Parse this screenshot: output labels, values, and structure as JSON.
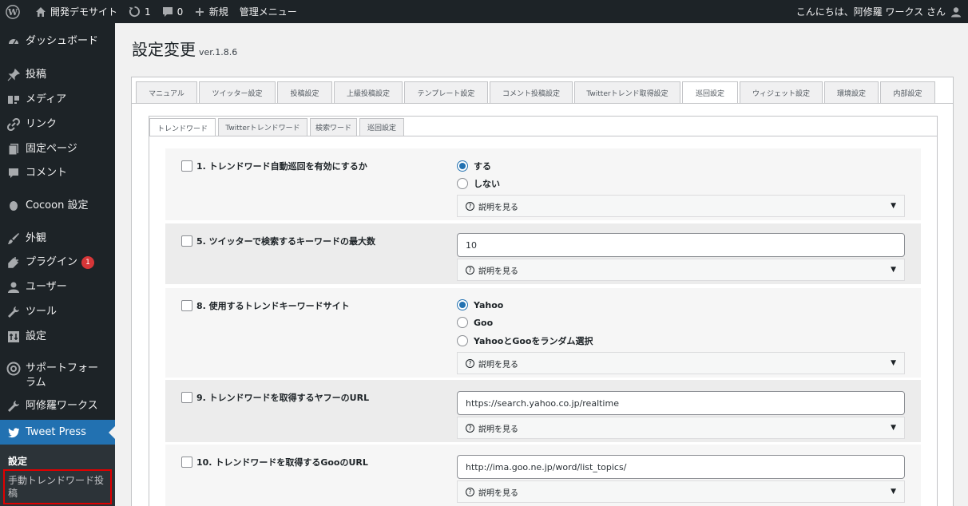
{
  "adminbar": {
    "site_name": "開発デモサイト",
    "updates_count": "1",
    "comments_count": "0",
    "new_label": "新規",
    "admin_menu_label": "管理メニュー",
    "greeting": "こんにちは、阿修羅 ワークス さん"
  },
  "sidebar": {
    "items": [
      {
        "label": "ダッシュボード",
        "icon": "dashboard-icon"
      },
      {
        "label": "投稿",
        "icon": "pin-icon"
      },
      {
        "label": "メディア",
        "icon": "media-icon"
      },
      {
        "label": "リンク",
        "icon": "link-icon"
      },
      {
        "label": "固定ページ",
        "icon": "page-icon"
      },
      {
        "label": "コメント",
        "icon": "comment-icon"
      },
      {
        "label": "Cocoon 設定",
        "icon": "cocoon-icon"
      },
      {
        "label": "外観",
        "icon": "brush-icon"
      },
      {
        "label": "プラグイン",
        "icon": "plugin-icon",
        "badge": "1"
      },
      {
        "label": "ユーザー",
        "icon": "user-icon"
      },
      {
        "label": "ツール",
        "icon": "wrench-icon"
      },
      {
        "label": "設定",
        "icon": "settings-icon"
      },
      {
        "label": "サポートフォーラム",
        "icon": "support-icon"
      },
      {
        "label": "阿修羅ワークス",
        "icon": "wrench-icon"
      },
      {
        "label": "Tweet Press",
        "icon": "twitter-icon"
      }
    ],
    "submenu": {
      "settings_label": "設定",
      "manual_post_label": "手動トレンドワード投稿"
    }
  },
  "page": {
    "title": "設定変更",
    "version": "ver.1.8.6"
  },
  "main_tabs": [
    "マニュアル",
    "ツイッター設定",
    "投稿設定",
    "上級投稿設定",
    "テンプレート設定",
    "コメント投稿設定",
    "Twitterトレンド取得設定",
    "巡回設定",
    "ウィジェット設定",
    "環境設定",
    "内部設定"
  ],
  "active_main_tab": "巡回設定",
  "sub_tabs": [
    "トレンドワード",
    "Twitterトレンドワード",
    "検索ワード",
    "巡回設定"
  ],
  "active_sub_tab": "トレンドワード",
  "desc_label": "説明を見る",
  "settings": {
    "s1": {
      "label": "1. トレンドワード自動巡回を有効にするか",
      "options": [
        "する",
        "しない"
      ],
      "selected": "する"
    },
    "s5": {
      "label": "5. ツイッターで検索するキーワードの最大数",
      "value": "10"
    },
    "s8": {
      "label": "8. 使用するトレンドキーワードサイト",
      "options": [
        "Yahoo",
        "Goo",
        "YahooとGooをランダム選択"
      ],
      "selected": "Yahoo"
    },
    "s9": {
      "label": "9. トレンドワードを取得するヤフーのURL",
      "value": "https://search.yahoo.co.jp/realtime"
    },
    "s10": {
      "label": "10. トレンドワードを取得するGooのURL",
      "value": "http://ima.goo.ne.jp/word/list_topics/"
    }
  }
}
